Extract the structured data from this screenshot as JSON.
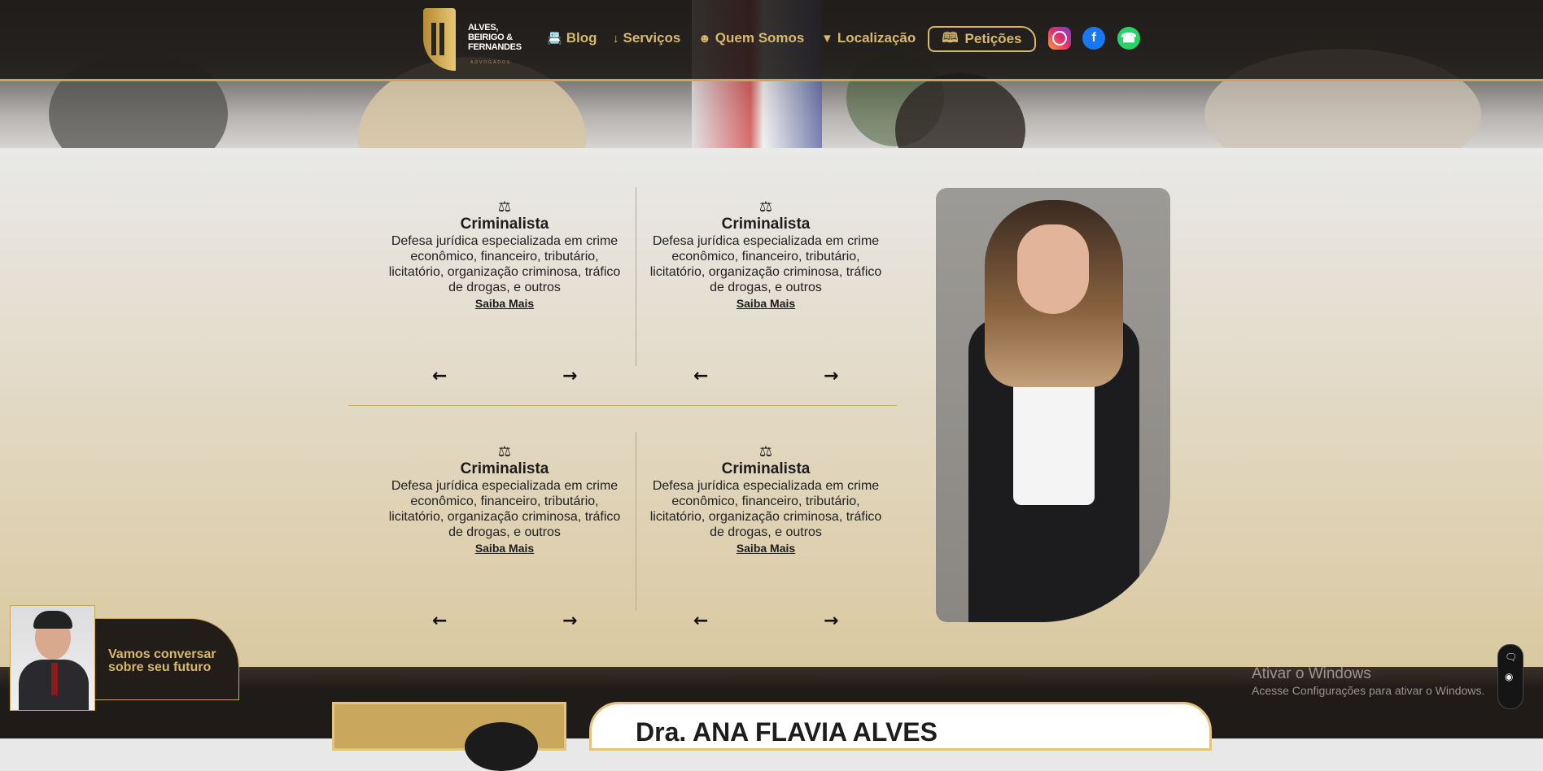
{
  "nav": {
    "logo_text": [
      "ALVES,",
      "BEIRIGO &",
      "FERNANDES"
    ],
    "logo_sub": "ADVOGADOS",
    "items": [
      {
        "label": "Blog",
        "icon": "id-card-icon"
      },
      {
        "label": "Serviços",
        "icon": "arrow-down-icon"
      },
      {
        "label": "Quem Somos",
        "icon": "user-icon"
      },
      {
        "label": "Localização",
        "icon": "map-pin-icon"
      }
    ],
    "petitions": "Petições",
    "social": [
      "instagram-icon",
      "facebook-icon",
      "whatsapp-icon"
    ]
  },
  "services": [
    {
      "title": "Criminalista",
      "description": "Defesa jurídica especializada em crime econômico, financeiro, tributário, licitatório, organização criminosa, tráfico de drogas, e outros",
      "link": "Saiba Mais"
    },
    {
      "title": "Criminalista",
      "description": "Defesa jurídica especializada em crime econômico, financeiro, tributário, licitatório, organização criminosa, tráfico de drogas, e outros",
      "link": "Saiba Mais"
    },
    {
      "title": "Criminalista",
      "description": "Defesa jurídica especializada em crime econômico, financeiro, tributário, licitatório, organização criminosa, tráfico de drogas, e outros",
      "link": "Saiba Mais"
    },
    {
      "title": "Criminalista",
      "description": "Defesa jurídica especializada em crime econômico, financeiro, tributário, licitatório, organização criminosa, tráfico de drogas, e outros",
      "link": "Saiba Mais"
    }
  ],
  "profile": {
    "name": "Dra. ANA FLAVIA ALVES"
  },
  "chat": {
    "line1": "Vamos conversar",
    "line2": "sobre seu futuro"
  },
  "watermark": {
    "title": "Ativar o Windows",
    "subtitle": "Acesse Configurações para ativar o Windows."
  },
  "colors": {
    "gold": "#d7b86c",
    "dark": "#1f1b18"
  }
}
